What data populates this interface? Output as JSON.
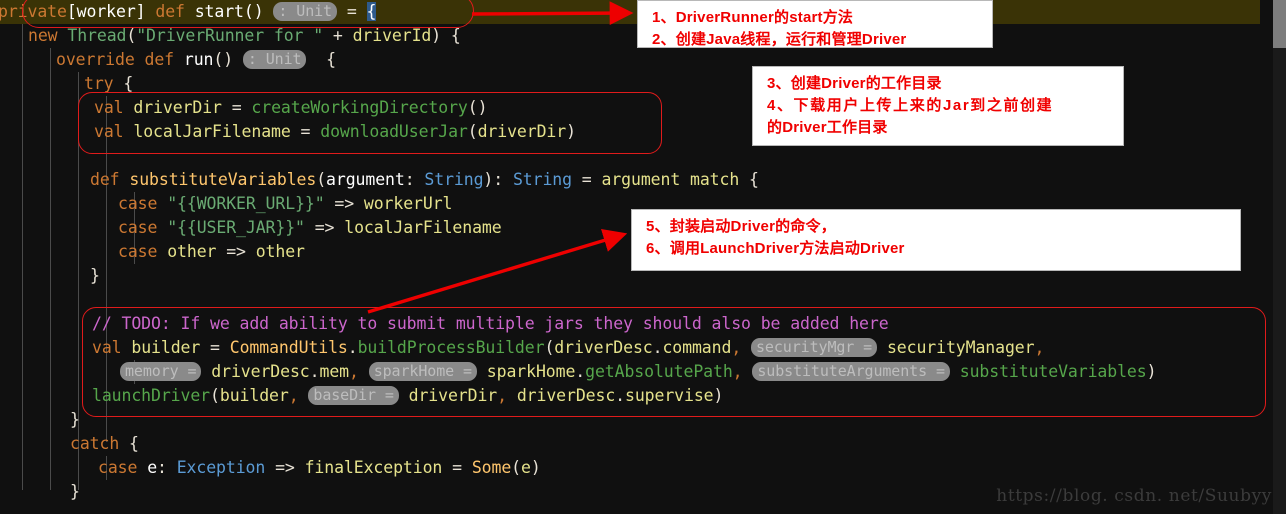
{
  "editor": {
    "language": "Scala",
    "background_color": "#101010",
    "highlight_line_color": "#3a3306",
    "selection_color": "#2e5a8c",
    "lines": [
      {
        "n": 1,
        "indent": 0,
        "text": "private[worker] def start() : Unit = {"
      },
      {
        "n": 2,
        "indent": 1,
        "text": "new Thread(\"DriverRunner for \" + driverId) {"
      },
      {
        "n": 3,
        "indent": 2,
        "text": "override def run() : Unit  {"
      },
      {
        "n": 4,
        "indent": 3,
        "text": "try {"
      },
      {
        "n": 5,
        "indent": 4,
        "text": "val driverDir = createWorkingDirectory()"
      },
      {
        "n": 6,
        "indent": 4,
        "text": "val localJarFilename = downloadUserJar(driverDir)"
      },
      {
        "n": 7,
        "indent": 4,
        "text": ""
      },
      {
        "n": 8,
        "indent": 4,
        "text": "def substituteVariables(argument: String): String = argument match {"
      },
      {
        "n": 9,
        "indent": 5,
        "text": "case \"{{WORKER_URL}}\" => workerUrl"
      },
      {
        "n": 10,
        "indent": 5,
        "text": "case \"{{USER_JAR}}\" => localJarFilename"
      },
      {
        "n": 11,
        "indent": 5,
        "text": "case other => other"
      },
      {
        "n": 12,
        "indent": 4,
        "text": "}"
      },
      {
        "n": 13,
        "indent": 4,
        "text": ""
      },
      {
        "n": 14,
        "indent": 4,
        "text": "// TODO: If we add ability to submit multiple jars they should also be added here"
      },
      {
        "n": 15,
        "indent": 4,
        "text": "val builder = CommandUtils.buildProcessBuilder(driverDesc.command, securityMgr = securityManager,"
      },
      {
        "n": 16,
        "indent": 5,
        "text": "memory = driverDesc.mem, sparkHome = sparkHome.getAbsolutePath, substituteArguments = substituteVariables)"
      },
      {
        "n": 17,
        "indent": 4,
        "text": "launchDriver(builder, baseDir = driverDir, driverDesc.supervise)"
      },
      {
        "n": 18,
        "indent": 3,
        "text": "}"
      },
      {
        "n": 19,
        "indent": 3,
        "text": "catch {"
      },
      {
        "n": 20,
        "indent": 4,
        "text": "case e: Exception => finalException = Some(e)"
      },
      {
        "n": 21,
        "indent": 3,
        "text": "}"
      }
    ],
    "inlay_hints": [
      "securityMgr =",
      "memory =",
      "sparkHome =",
      "substituteArguments =",
      "baseDir =",
      ": Unit"
    ]
  },
  "annotations": {
    "note1": {
      "lines": [
        "1、DriverRunner的start方法",
        "2、创建Java线程，运行和管理Driver"
      ]
    },
    "note2": {
      "lines": [
        "3、创建Driver的工作目录",
        "4、下载用户上传上来的Jar到之前创建",
        "的Driver工作目录"
      ]
    },
    "note3": {
      "lines": [
        "5、封装启动Driver的命令，",
        "6、调用LaunchDriver方法启动Driver"
      ]
    },
    "outline_color": "#e01b1b",
    "arrow_color": "#ee0000"
  },
  "watermark": {
    "text": "https://blog. csdn. net/Suubyy"
  },
  "scrollbar": {
    "thumb_color": "#7d7d7d",
    "track_color": "#1a1a1a"
  }
}
